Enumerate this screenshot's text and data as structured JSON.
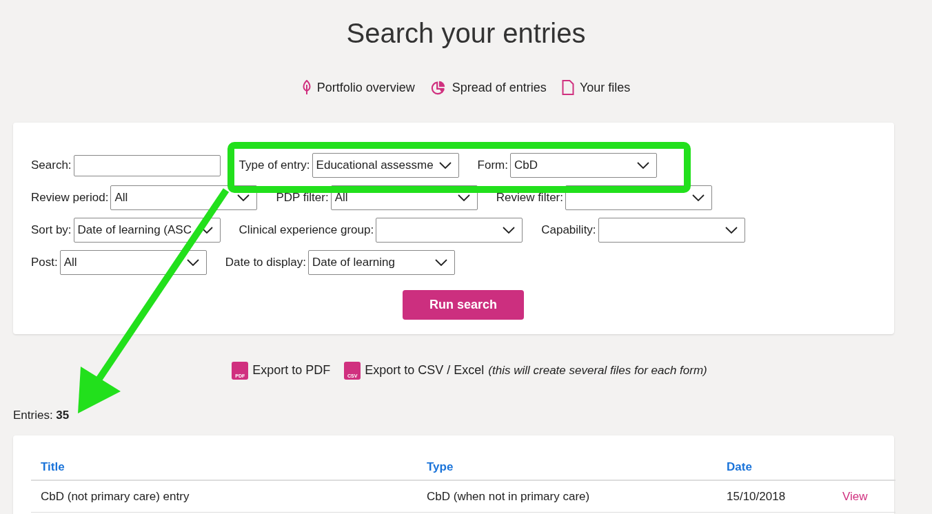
{
  "page_title": "Search your entries",
  "nav_links": [
    {
      "label": "Portfolio overview",
      "kind": "leaf"
    },
    {
      "label": "Spread of entries",
      "kind": "pie"
    },
    {
      "label": "Your files",
      "kind": "file"
    }
  ],
  "filter_rows": [
    [
      {
        "label": "Search:",
        "kind": "text"
      },
      {
        "label": "Type of entry:",
        "kind": "select",
        "value": "Educational assessme"
      },
      {
        "label": "Form:",
        "kind": "select",
        "value": "CbD"
      }
    ],
    [
      {
        "label": "Review period:",
        "kind": "select",
        "value": "All"
      },
      {
        "label": "PDP filter:",
        "kind": "select",
        "value": "All"
      },
      {
        "label": "Review filter:",
        "kind": "select"
      }
    ],
    [
      {
        "label": "Sort by:",
        "kind": "select",
        "value": "Date of learning (ASC"
      },
      {
        "label": "Clinical experience group:",
        "kind": "select"
      },
      {
        "label": "Capability:",
        "kind": "select"
      }
    ],
    [
      {
        "label": "Post:",
        "kind": "select",
        "value": "All"
      },
      {
        "label": "Date to display:",
        "kind": "select",
        "value": "Date of learning"
      }
    ]
  ],
  "run_button": "Run search",
  "exports": [
    {
      "icon_text": "PDF",
      "label": "Export to PDF"
    },
    {
      "icon_text": "CSV",
      "label": "Export to CSV / Excel",
      "note": "(this will create several files for each form)"
    }
  ],
  "entries_label": "Entries:",
  "entries_count": "35",
  "table": {
    "columns": [
      "Title",
      "Type",
      "Date"
    ],
    "rows": [
      {
        "title": "CbD (not primary care) entry",
        "type": "CbD (when not in primary care)",
        "date": "15/10/2018",
        "action": "View"
      }
    ]
  }
}
